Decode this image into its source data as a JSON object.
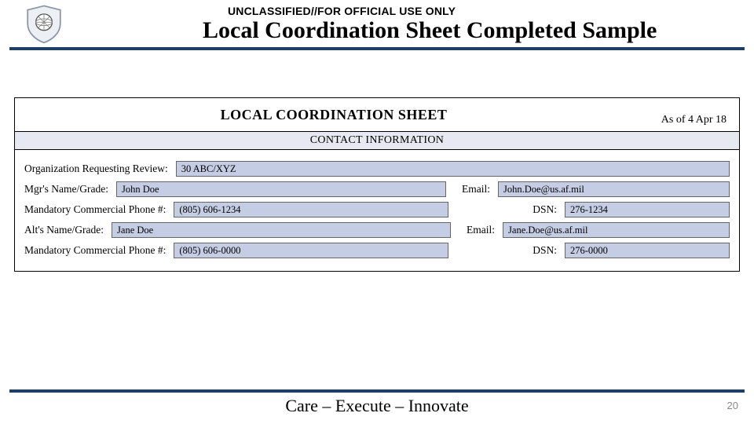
{
  "header": {
    "classification": "UNCLASSIFIED//FOR OFFICIAL USE ONLY",
    "title": "Local Coordination Sheet Completed Sample"
  },
  "form": {
    "title": "LOCAL COORDINATION SHEET",
    "as_of": "As of 4 Apr 18",
    "section": "CONTACT INFORMATION",
    "fields": {
      "org_label": "Organization  Requesting Review:",
      "org_value": "30 ABC/XYZ",
      "mgr_label": "Mgr's Name/Grade:",
      "mgr_value": "John Doe",
      "mgr_email_label": "Email:",
      "mgr_email_value": "John.Doe@us.af.mil",
      "mgr_phone_label": "Mandatory Commercial Phone #:",
      "mgr_phone_value": "(805) 606-1234",
      "mgr_dsn_label": "DSN:",
      "mgr_dsn_value": "276-1234",
      "alt_label": "Alt's Name/Grade:",
      "alt_value": "Jane Doe",
      "alt_email_label": "Email:",
      "alt_email_value": "Jane.Doe@us.af.mil",
      "alt_phone_label": "Mandatory Commercial Phone #:",
      "alt_phone_value": "(805) 606-0000",
      "alt_dsn_label": "DSN:",
      "alt_dsn_value": "276-0000"
    }
  },
  "footer": {
    "motto": "Care – Execute – Innovate",
    "page": "20"
  }
}
